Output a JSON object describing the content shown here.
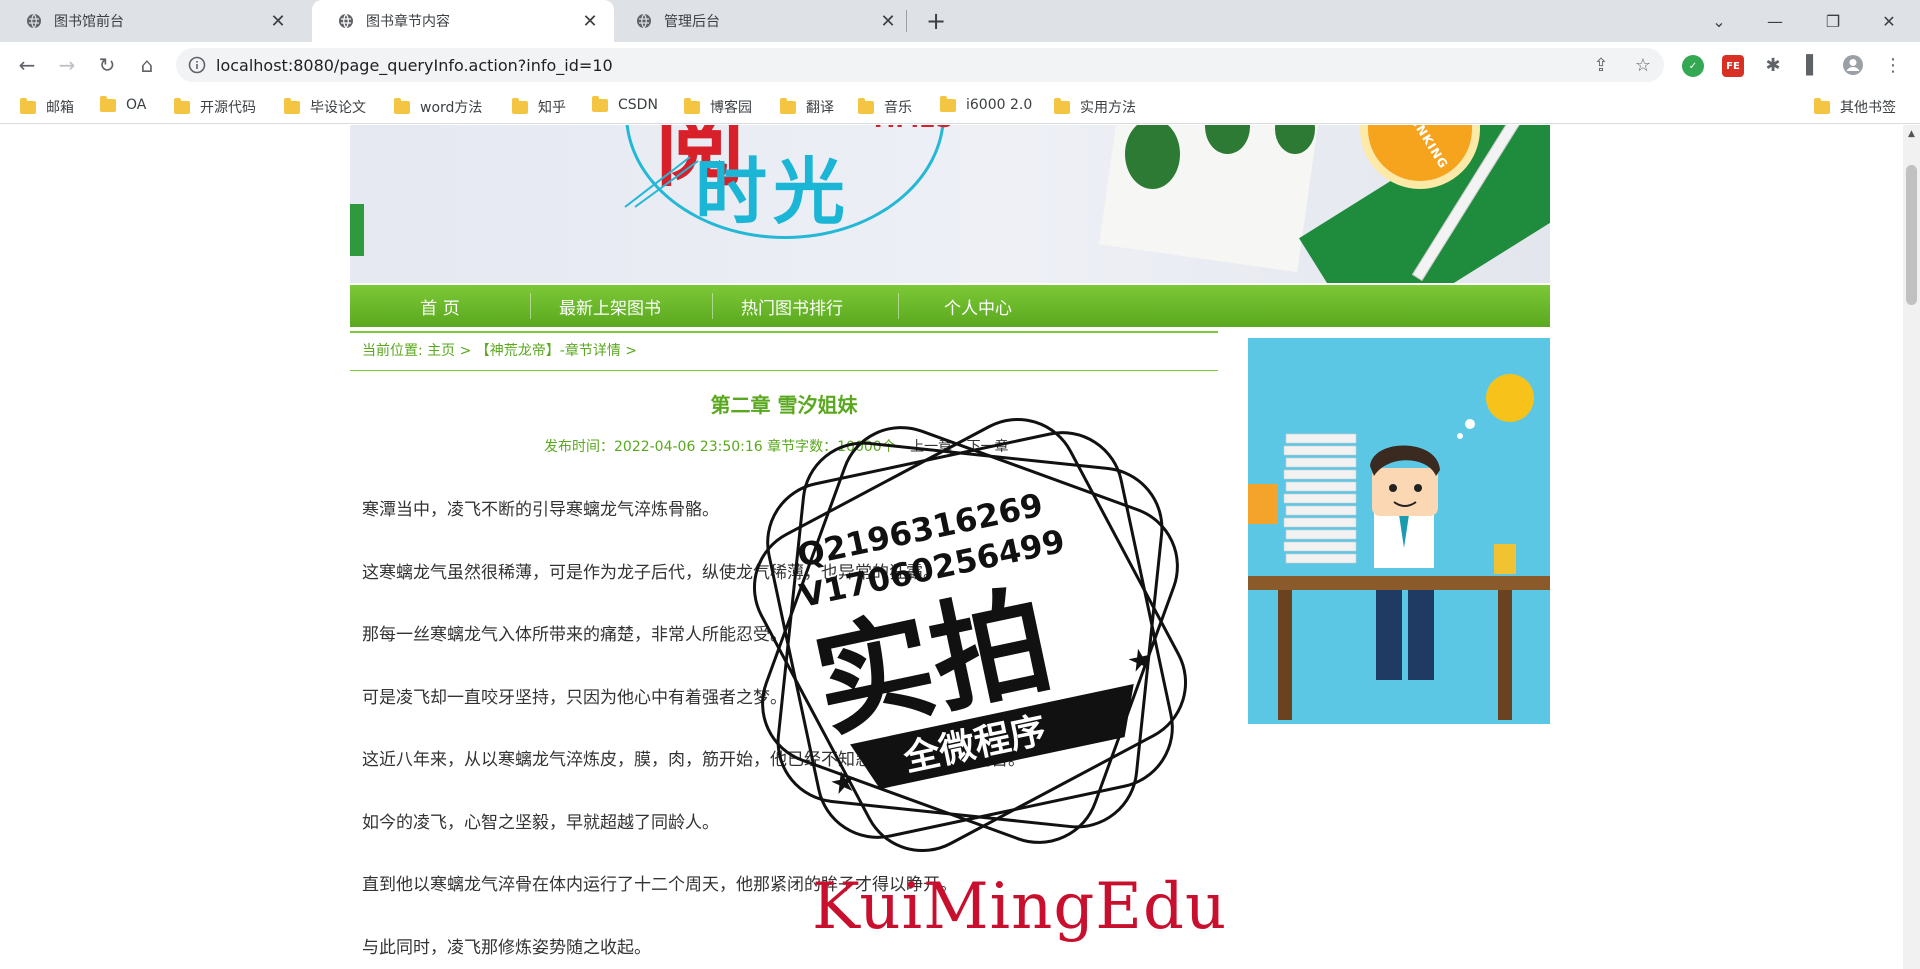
{
  "browser": {
    "tabs": [
      {
        "title": "图书馆前台",
        "active": false
      },
      {
        "title": "图书章节内容",
        "active": true
      },
      {
        "title": "管理后台",
        "active": false
      }
    ],
    "url": "localhost:8080/page_queryInfo.action?info_id=10",
    "bookmarks": [
      "邮箱",
      "OA",
      "开源代码",
      "毕设论文",
      "word方法",
      "知乎",
      "CSDN",
      "博客园",
      "翻译",
      "音乐",
      "i6000 2.0",
      "实用方法"
    ],
    "other_bookmarks": "其他书签",
    "ext_fe_label": "FE"
  },
  "site": {
    "nav": [
      "首 页",
      "最新上架图书",
      "热门图书排行",
      "个人中心"
    ],
    "breadcrumb": "当前位置: 主页 > 【神荒龙帝】-章节详情 >",
    "chapter_title": "第二章 雪汐姐妹",
    "meta": "发布时间：2022-04-06 23:50:16   章节字数：10000个",
    "prev_chapter": "上一章",
    "next_chapter": "下一章",
    "paragraphs": [
      "寒潭当中，凌飞不断的引导寒螭龙气淬炼骨骼。",
      "这寒螭龙气虽然很稀薄，可是作为龙子后代，纵使龙气稀薄，也异常的狂霸。",
      "那每一丝寒螭龙气入体所带来的痛楚，非常人所能忍受。",
      "可是凌飞却一直咬牙坚持，只因为他心中有着强者之梦。",
      "这近八年来，从以寒螭龙气淬炼皮，膜，肉，筋开始，他已经不知忍受了多久这种痛苦。",
      "如今的凌飞，心智之坚毅，早就超越了同龄人。",
      "直到他以寒螭龙气淬骨在体内运行了十二个周天，他那紧闭的眸子才得以睁开。",
      "与此同时，凌飞那修炼姿势随之收起。"
    ]
  },
  "watermark": {
    "line1": "Q2196316269",
    "line2": "V17060256499",
    "big": "实拍",
    "ribbon": "全微程序",
    "signature": "KuiMingEdu"
  },
  "colors": {
    "accent_green": "#5aa81f",
    "nav_green": "#7cc837",
    "watermark_red": "#c8102e"
  }
}
